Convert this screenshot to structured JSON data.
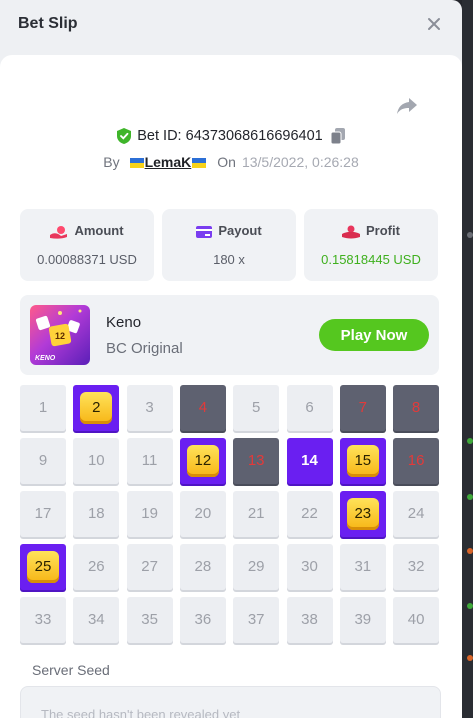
{
  "header": {
    "title": "Bet Slip"
  },
  "bet": {
    "id_label": "Bet ID:",
    "id_value": "64373068616696401",
    "by_label": "By",
    "username": "LemaK",
    "on_label": "On",
    "date": "13/5/2022, 0:26:28"
  },
  "stats": [
    {
      "label": "Amount",
      "value": "0.00088371 USD"
    },
    {
      "label": "Payout",
      "value": "180 x"
    },
    {
      "label": "Profit",
      "value": "0.15818445 USD"
    }
  ],
  "game": {
    "name": "Keno",
    "subtitle": "BC Original",
    "thumb_text": "KENO",
    "play_label": "Play Now"
  },
  "grid": {
    "numbers": [
      "1",
      "2",
      "3",
      "4",
      "5",
      "6",
      "7",
      "8",
      "9",
      "10",
      "11",
      "12",
      "13",
      "14",
      "15",
      "16",
      "17",
      "18",
      "19",
      "20",
      "21",
      "22",
      "23",
      "24",
      "25",
      "26",
      "27",
      "28",
      "29",
      "30",
      "31",
      "32",
      "33",
      "34",
      "35",
      "36",
      "37",
      "38",
      "39",
      "40"
    ],
    "hits": [
      2,
      12,
      15,
      23,
      25
    ],
    "picked_miss": [
      14
    ],
    "drawn_miss": [
      4,
      7,
      8,
      13,
      16
    ]
  },
  "seed": {
    "label": "Server Seed",
    "placeholder": "The seed hasn't been revealed yet"
  },
  "colors": {
    "accent_green": "#55c71f",
    "profit_green": "#3fb01e",
    "hit_purple": "#6a1ff1",
    "drawn_dark": "#5e6170",
    "drawn_red": "#e23a3a"
  },
  "icons": {
    "close": "close-icon",
    "share": "share-icon",
    "verified": "shield-check-icon",
    "copy": "copy-icon",
    "amount": "coin-hand-icon",
    "payout": "card-icon",
    "profit": "profit-hand-icon"
  }
}
